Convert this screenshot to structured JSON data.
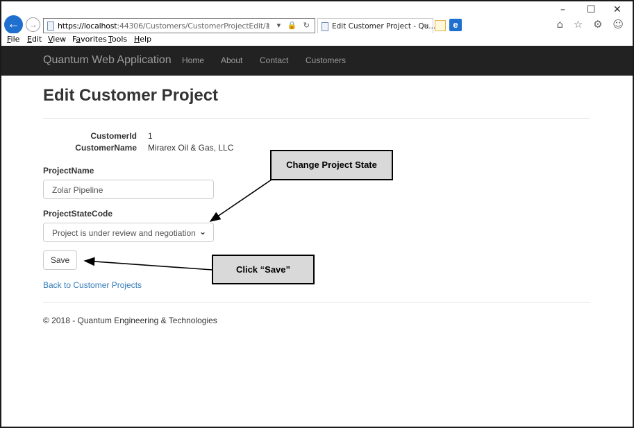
{
  "browser": {
    "url_prefix": "https://localhost",
    "url_rest": ":44306/Customers/CustomerProjectEdit/1",
    "tab_title": "Edit Customer Project - Qu...",
    "tab_close": "×",
    "address_icons": "⌕ ▾ 🔒 ↻",
    "minimize": "–",
    "maximize": "☐",
    "close": "✕",
    "toolbar_icons": "⌂ ☆ ⚙ ☺",
    "back_glyph": "←",
    "forward_glyph": "→",
    "edge_glyph": "e"
  },
  "menu": [
    {
      "label": "File",
      "accel": "F",
      "rest": "ile"
    },
    {
      "label": "Edit",
      "accel": "E",
      "rest": "dit"
    },
    {
      "label": "View",
      "accel": "V",
      "rest": "iew"
    },
    {
      "label": "Favorites",
      "accel": "a",
      "pre": "F",
      "rest": "vorites"
    },
    {
      "label": "Tools",
      "accel": "T",
      "rest": "ools"
    },
    {
      "label": "Help",
      "accel": "H",
      "rest": "elp"
    }
  ],
  "navbar": {
    "brand": "Quantum Web Application",
    "links": [
      "Home",
      "About",
      "Contact",
      "Customers"
    ]
  },
  "page": {
    "title": "Edit Customer Project",
    "customer_id_label": "CustomerId",
    "customer_id_value": "1",
    "customer_name_label": "CustomerName",
    "customer_name_value": "Mirarex Oil & Gas, LLC",
    "project_name_label": "ProjectName",
    "project_name_value": "Zolar Pipeline",
    "project_state_label": "ProjectStateCode",
    "project_state_value": "Project is under review and negotiation",
    "save_label": "Save",
    "back_link": "Back to Customer Projects",
    "footer": "© 2018 - Quantum Engineering & Technologies"
  },
  "callouts": {
    "change_state": "Change Project State",
    "click_save": "Click “Save”"
  }
}
